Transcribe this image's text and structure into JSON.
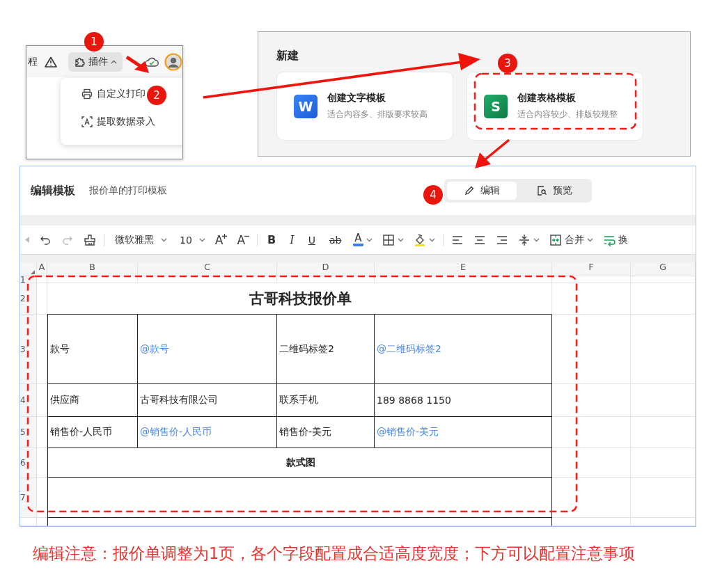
{
  "plugin_panel": {
    "cut_text": "程",
    "plugin_button": {
      "label": "插件",
      "expanded": true
    },
    "menu_items": [
      {
        "kind": "print",
        "label": "自定义打印"
      },
      {
        "kind": "extract",
        "label": "提取数据录入"
      }
    ]
  },
  "new_panel": {
    "heading": "新建",
    "cards": [
      {
        "kind": "word",
        "letter": "W",
        "title": "创建文字模板",
        "subtitle": "适合内容多、排版要求较高"
      },
      {
        "kind": "sheet",
        "letter": "S",
        "title": "创建表格模板",
        "subtitle": "适合内容较少、排版较规整"
      }
    ]
  },
  "editor": {
    "title": "编辑模板",
    "subtitle": "报价单的打印模板",
    "modes": [
      {
        "kind": "edit",
        "label": "编辑",
        "selected": true
      },
      {
        "kind": "preview",
        "label": "预览",
        "selected": false
      }
    ],
    "toolbar": [
      {
        "kind": "back",
        "disabled": true
      },
      {
        "kind": "undo",
        "disabled": false
      },
      {
        "kind": "redo",
        "disabled": true
      },
      {
        "kind": "painter",
        "disabled": false
      },
      {
        "kind": "separator",
        "disabled": false
      },
      {
        "kind": "dropdown",
        "label": "微软雅黑",
        "disabled": false
      },
      {
        "kind": "dropdown",
        "label": "10",
        "disabled": false
      },
      {
        "kind": "grow",
        "label": "A",
        "disabled": false
      },
      {
        "kind": "shrink",
        "label": "A",
        "disabled": false
      },
      {
        "kind": "separator",
        "disabled": false
      },
      {
        "kind": "bold",
        "label": "B",
        "disabled": false
      },
      {
        "kind": "italic",
        "label": "I",
        "disabled": false
      },
      {
        "kind": "underline",
        "label": "U",
        "disabled": false
      },
      {
        "kind": "strike",
        "label": "ab",
        "disabled": false
      },
      {
        "kind": "font-color",
        "label": "A",
        "disabled": false
      },
      {
        "kind": "borders",
        "disabled": false
      },
      {
        "kind": "fill",
        "disabled": false
      },
      {
        "kind": "separator",
        "disabled": false
      },
      {
        "kind": "align-left",
        "disabled": false
      },
      {
        "kind": "align-center",
        "disabled": false
      },
      {
        "kind": "align-right",
        "disabled": false
      },
      {
        "kind": "valign",
        "disabled": false
      },
      {
        "kind": "merge",
        "label": "合并",
        "disabled": false
      },
      {
        "kind": "wrap",
        "label": "换",
        "disabled": false
      }
    ],
    "sheet": {
      "columns": [
        "A",
        "B",
        "C",
        "D",
        "E",
        "F",
        "G"
      ],
      "row_numbers": [
        "1",
        "2",
        "3",
        "4",
        "5",
        "6",
        "7"
      ],
      "title": "古哥科技报价单",
      "rows": [
        [
          "",
          {
            "kind": "label",
            "text": "款号"
          },
          {
            "kind": "field",
            "text": "@款号"
          },
          {
            "kind": "label",
            "text": "二维码标签2"
          },
          {
            "kind": "field",
            "text": "@二维码标签2"
          }
        ],
        [
          "",
          {
            "kind": "label",
            "text": "供应商"
          },
          {
            "kind": "label",
            "text": "古哥科技有限公司"
          },
          {
            "kind": "label",
            "text": "联系手机"
          },
          {
            "kind": "label",
            "text": "189 8868 1150"
          }
        ],
        [
          "",
          {
            "kind": "label",
            "text": "销售价-人民币"
          },
          {
            "kind": "field",
            "text": "@销售价-人民币"
          },
          {
            "kind": "label",
            "text": "销售价-美元"
          },
          {
            "kind": "field",
            "text": "@销售价-美元"
          }
        ]
      ],
      "section": "款式图"
    }
  },
  "annotations": {
    "steps": [
      "1",
      "2",
      "3",
      "4"
    ],
    "note": "编辑注意：报价单调整为1页，各个字段配置成合适高度宽度；下方可以配置注意事项"
  }
}
